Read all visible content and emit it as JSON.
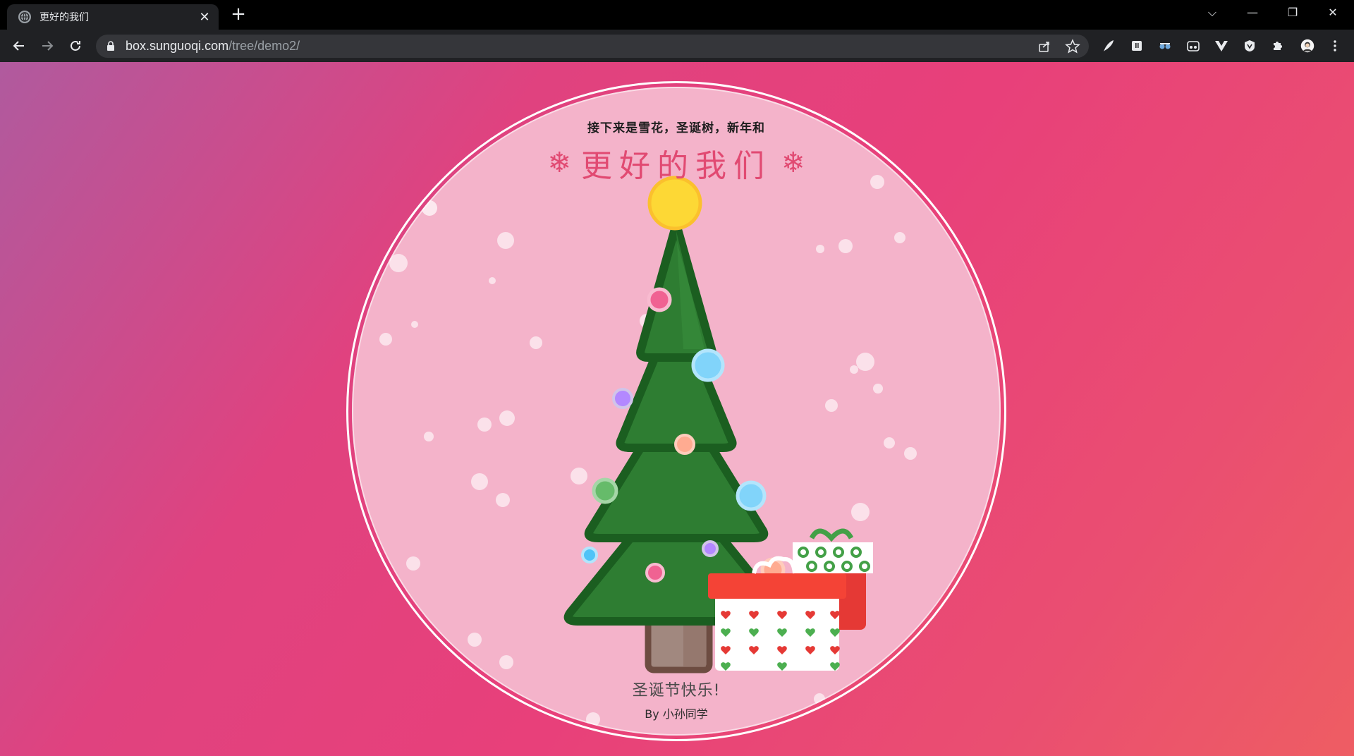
{
  "browser": {
    "tab_title": "更好的我们",
    "tab_close": "✕",
    "new_tab": "+",
    "url_host": "box.sunguoqi.com",
    "url_path": "/tree/demo2/",
    "window_controls": {
      "tabs_menu": "⌵",
      "minimize": "—",
      "restore": "❐",
      "close": "✕"
    }
  },
  "page": {
    "subtitle": "接下来是雪花，圣诞树，新年和",
    "title": "更好的我们",
    "title_flake": "❄",
    "greeting": "圣诞节快乐!",
    "author": "By 小孙同学"
  },
  "colors": {
    "tree": "#2f7d32",
    "tree_outline": "#1b5e20",
    "star": "#fdd835",
    "gift_red": "#e53935",
    "title_pink": "#e14a72"
  }
}
